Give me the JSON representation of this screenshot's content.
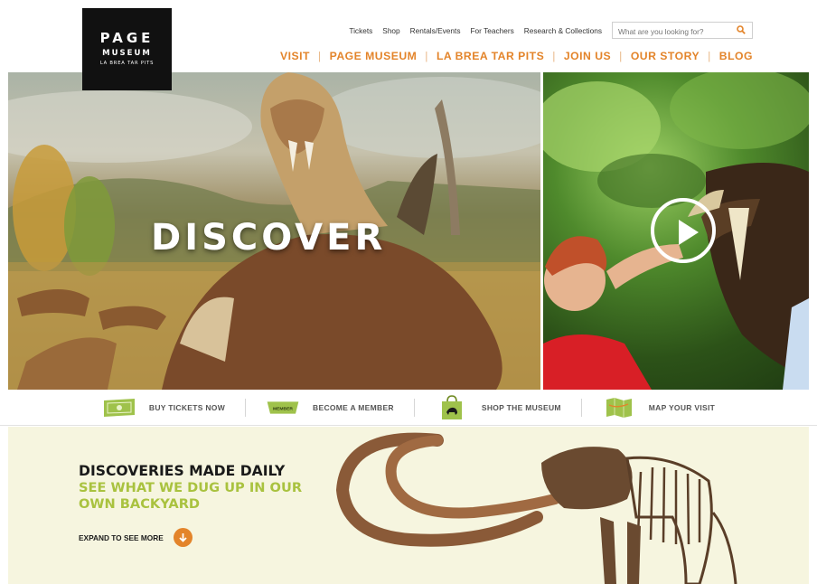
{
  "logo": {
    "line1": "PAGE",
    "line2": "MUSEUM",
    "line3": "LA BREA TAR PITS"
  },
  "util_nav": [
    "Tickets",
    "Shop",
    "Rentals/Events",
    "For Teachers",
    "Research & Collections"
  ],
  "search": {
    "placeholder": "What are you looking for?",
    "icon": "search-icon"
  },
  "main_nav": [
    "VISIT",
    "PAGE MUSEUM",
    "LA BREA TAR PITS",
    "JOIN US",
    "OUR STORY",
    "BLOG"
  ],
  "hero": {
    "headline": "DISCOVER",
    "video_icon": "play-icon"
  },
  "actions": [
    {
      "label": "BUY TICKETS NOW",
      "icon": "ticket-icon"
    },
    {
      "label": "BECOME A MEMBER",
      "icon": "member-card-icon",
      "icon_text": "MEMBER"
    },
    {
      "label": "SHOP THE MUSEUM",
      "icon": "shopping-bag-icon"
    },
    {
      "label": "MAP YOUR VISIT",
      "icon": "map-icon"
    }
  ],
  "promo": {
    "title": "DISCOVERIES MADE DAILY",
    "subtitle": "SEE WHAT WE DUG UP IN OUR OWN BACKYARD",
    "expand_label": "EXPAND TO SEE MORE"
  },
  "colors": {
    "accent_orange": "#e3842a",
    "accent_green": "#a9c23f",
    "promo_bg": "#f6f5df"
  }
}
